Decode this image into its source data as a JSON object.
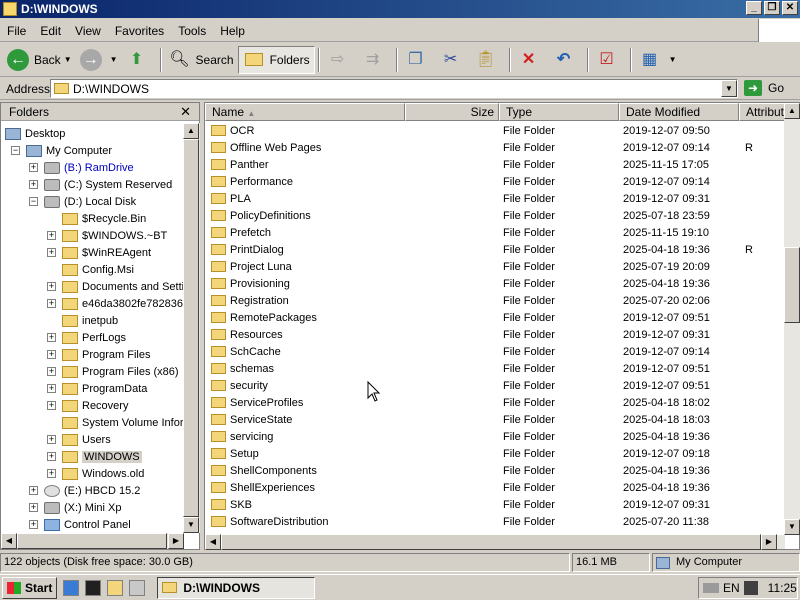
{
  "window": {
    "title": "D:\\WINDOWS"
  },
  "menu": [
    "File",
    "Edit",
    "View",
    "Favorites",
    "Tools",
    "Help"
  ],
  "toolbar": {
    "back": "Back",
    "search": "Search",
    "folders": "Folders"
  },
  "address": {
    "label": "Address",
    "value": "D:\\WINDOWS",
    "go": "Go"
  },
  "folders_pane": {
    "title": "Folders",
    "tree": [
      {
        "label": "Desktop",
        "level": 0,
        "expander": "",
        "icon": "desktop-icon"
      },
      {
        "label": "My Computer",
        "level": 1,
        "expander": "−",
        "icon": "computer-icon"
      },
      {
        "label": "(B:) RamDrive",
        "level": 2,
        "expander": "+",
        "icon": "drive-icon",
        "color": "blue"
      },
      {
        "label": "(C:) System Reserved",
        "level": 2,
        "expander": "+",
        "icon": "drive-icon"
      },
      {
        "label": "(D:) Local Disk",
        "level": 2,
        "expander": "−",
        "icon": "drive-icon"
      },
      {
        "label": "$Recycle.Bin",
        "level": 3,
        "expander": "",
        "icon": "folder-icon"
      },
      {
        "label": "$WINDOWS.~BT",
        "level": 3,
        "expander": "+",
        "icon": "folder-icon"
      },
      {
        "label": "$WinREAgent",
        "level": 3,
        "expander": "+",
        "icon": "folder-icon"
      },
      {
        "label": "Config.Msi",
        "level": 3,
        "expander": "",
        "icon": "folder-icon"
      },
      {
        "label": "Documents and Setti",
        "level": 3,
        "expander": "+",
        "icon": "folder-icon"
      },
      {
        "label": "e46da3802fe782836",
        "level": 3,
        "expander": "+",
        "icon": "folder-icon"
      },
      {
        "label": "inetpub",
        "level": 3,
        "expander": "",
        "icon": "folder-icon"
      },
      {
        "label": "PerfLogs",
        "level": 3,
        "expander": "+",
        "icon": "folder-icon"
      },
      {
        "label": "Program Files",
        "level": 3,
        "expander": "+",
        "icon": "folder-icon"
      },
      {
        "label": "Program Files (x86)",
        "level": 3,
        "expander": "+",
        "icon": "folder-icon"
      },
      {
        "label": "ProgramData",
        "level": 3,
        "expander": "+",
        "icon": "folder-icon"
      },
      {
        "label": "Recovery",
        "level": 3,
        "expander": "+",
        "icon": "folder-icon"
      },
      {
        "label": "System Volume Inform",
        "level": 3,
        "expander": "",
        "icon": "folder-icon"
      },
      {
        "label": "Users",
        "level": 3,
        "expander": "+",
        "icon": "folder-icon"
      },
      {
        "label": "WINDOWS",
        "level": 3,
        "expander": "+",
        "icon": "folder-icon",
        "selected": true
      },
      {
        "label": "Windows.old",
        "level": 3,
        "expander": "+",
        "icon": "folder-icon"
      },
      {
        "label": "(E:) HBCD 15.2",
        "level": 2,
        "expander": "+",
        "icon": "cdrom-icon"
      },
      {
        "label": "(X:) Mini Xp",
        "level": 2,
        "expander": "+",
        "icon": "drive-icon"
      },
      {
        "label": "Control Panel",
        "level": 2,
        "expander": "+",
        "icon": "control-panel-icon"
      }
    ]
  },
  "columns": {
    "name": "Name",
    "size": "Size",
    "type": "Type",
    "date": "Date Modified",
    "attr": "Attribut"
  },
  "files": [
    {
      "name": "OCR",
      "type": "File Folder",
      "date": "2019-12-07 09:50",
      "attr": ""
    },
    {
      "name": "Offline Web Pages",
      "type": "File Folder",
      "date": "2019-12-07 09:14",
      "attr": "R"
    },
    {
      "name": "Panther",
      "type": "File Folder",
      "date": "2025-11-15 17:05",
      "attr": ""
    },
    {
      "name": "Performance",
      "type": "File Folder",
      "date": "2019-12-07 09:14",
      "attr": ""
    },
    {
      "name": "PLA",
      "type": "File Folder",
      "date": "2019-12-07 09:31",
      "attr": ""
    },
    {
      "name": "PolicyDefinitions",
      "type": "File Folder",
      "date": "2025-07-18 23:59",
      "attr": ""
    },
    {
      "name": "Prefetch",
      "type": "File Folder",
      "date": "2025-11-15 19:10",
      "attr": ""
    },
    {
      "name": "PrintDialog",
      "type": "File Folder",
      "date": "2025-04-18 19:36",
      "attr": "R"
    },
    {
      "name": "Project Luna",
      "type": "File Folder",
      "date": "2025-07-19 20:09",
      "attr": ""
    },
    {
      "name": "Provisioning",
      "type": "File Folder",
      "date": "2025-04-18 19:36",
      "attr": ""
    },
    {
      "name": "Registration",
      "type": "File Folder",
      "date": "2025-07-20 02:06",
      "attr": ""
    },
    {
      "name": "RemotePackages",
      "type": "File Folder",
      "date": "2019-12-07 09:51",
      "attr": ""
    },
    {
      "name": "Resources",
      "type": "File Folder",
      "date": "2019-12-07 09:31",
      "attr": ""
    },
    {
      "name": "SchCache",
      "type": "File Folder",
      "date": "2019-12-07 09:14",
      "attr": ""
    },
    {
      "name": "schemas",
      "type": "File Folder",
      "date": "2019-12-07 09:51",
      "attr": ""
    },
    {
      "name": "security",
      "type": "File Folder",
      "date": "2019-12-07 09:51",
      "attr": ""
    },
    {
      "name": "ServiceProfiles",
      "type": "File Folder",
      "date": "2025-04-18 18:02",
      "attr": ""
    },
    {
      "name": "ServiceState",
      "type": "File Folder",
      "date": "2025-04-18 18:03",
      "attr": ""
    },
    {
      "name": "servicing",
      "type": "File Folder",
      "date": "2025-04-18 19:36",
      "attr": ""
    },
    {
      "name": "Setup",
      "type": "File Folder",
      "date": "2019-12-07 09:18",
      "attr": ""
    },
    {
      "name": "ShellComponents",
      "type": "File Folder",
      "date": "2025-04-18 19:36",
      "attr": ""
    },
    {
      "name": "ShellExperiences",
      "type": "File Folder",
      "date": "2025-04-18 19:36",
      "attr": ""
    },
    {
      "name": "SKB",
      "type": "File Folder",
      "date": "2019-12-07 09:31",
      "attr": ""
    },
    {
      "name": "SoftwareDistribution",
      "type": "File Folder",
      "date": "2025-07-20 11:38",
      "attr": ""
    }
  ],
  "status": {
    "objects": "122 objects (Disk free space: 30.0 GB)",
    "size": "16.1 MB",
    "location": "My Computer"
  },
  "taskbar": {
    "start": "Start",
    "task": "D:\\WINDOWS",
    "lang": "EN",
    "clock": "11:25"
  },
  "colors": {
    "titlebar_start": "#0a246a",
    "titlebar_end": "#3a6ea5",
    "face": "#d4d0c8",
    "link_blue": "#0000c0"
  }
}
